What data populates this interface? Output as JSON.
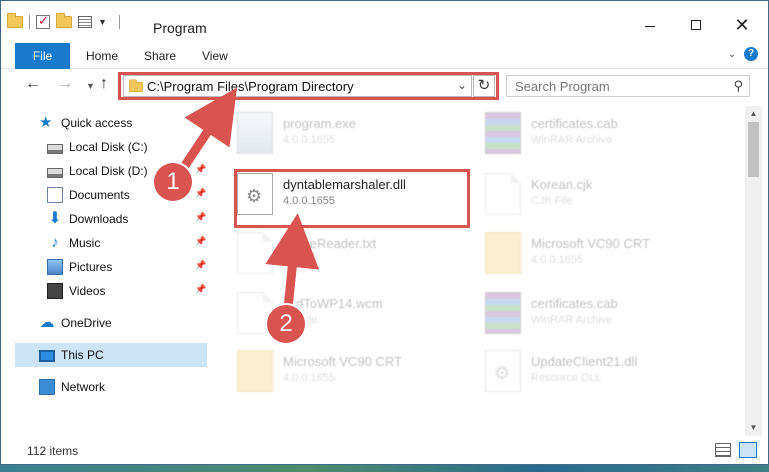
{
  "window": {
    "title": "Program"
  },
  "ribbon": {
    "tabs": [
      "File",
      "Home",
      "Share",
      "View"
    ]
  },
  "navigation": {
    "address": "C:\\Program Files\\Program Directory",
    "search_placeholder": "Search Program"
  },
  "sidebar": {
    "items": [
      {
        "label": "Quick access",
        "icon": "star-icon"
      },
      {
        "label": "Local Disk (C:)",
        "icon": "disk-icon",
        "pinned": true
      },
      {
        "label": "Local Disk (D:)",
        "icon": "disk-icon",
        "pinned": true
      },
      {
        "label": "Documents",
        "icon": "documents-icon",
        "pinned": true
      },
      {
        "label": "Downloads",
        "icon": "downloads-icon",
        "pinned": true
      },
      {
        "label": "Music",
        "icon": "music-icon",
        "pinned": true
      },
      {
        "label": "Pictures",
        "icon": "pictures-icon",
        "pinned": true
      },
      {
        "label": "Videos",
        "icon": "videos-icon",
        "pinned": true
      },
      {
        "label": "OneDrive",
        "icon": "onedrive-icon"
      },
      {
        "label": "This PC",
        "icon": "this-pc-icon",
        "selected": true
      },
      {
        "label": "Network",
        "icon": "network-icon"
      }
    ]
  },
  "files": [
    {
      "name": "program.exe",
      "meta": "4.0.0.1655",
      "icon": "exe-icon",
      "faded": true
    },
    {
      "name": "certificates.cab",
      "meta": "WinRAR Archive",
      "icon": "archive-icon",
      "faded": true
    },
    {
      "name": "dyntablemarshaler.dll",
      "meta": "4.0.0.1655",
      "icon": "dll-gear-icon",
      "faded": false
    },
    {
      "name": "Korean.cjk",
      "meta": "CJK File",
      "icon": "document-icon",
      "faded": true
    },
    {
      "name": "…fineReader.txt",
      "meta": "File",
      "icon": "document-icon",
      "faded": true
    },
    {
      "name": "Microsoft VC90 CRT",
      "meta": "4.0.0.1655",
      "icon": "folder-icon",
      "faded": true
    },
    {
      "name": "…dToWP14.wcm",
      "meta": "…l File",
      "icon": "document-icon",
      "faded": true
    },
    {
      "name": "certificates.cab",
      "meta": "WinRAR Archive",
      "icon": "archive-icon",
      "faded": true
    },
    {
      "name": "Microsoft VC90 CRT",
      "meta": "4.0.0.1655",
      "icon": "folder-icon",
      "faded": true
    },
    {
      "name": "UpdateClient21.dll",
      "meta": "Resource DLL",
      "icon": "dll-gear-icon",
      "faded": true
    }
  ],
  "annotations": {
    "step1": "1",
    "step2": "2",
    "color": "#d9534f"
  },
  "status": {
    "item_count": "112 items"
  },
  "colors": {
    "accent": "#1979ca",
    "selection": "#cce4f7"
  }
}
